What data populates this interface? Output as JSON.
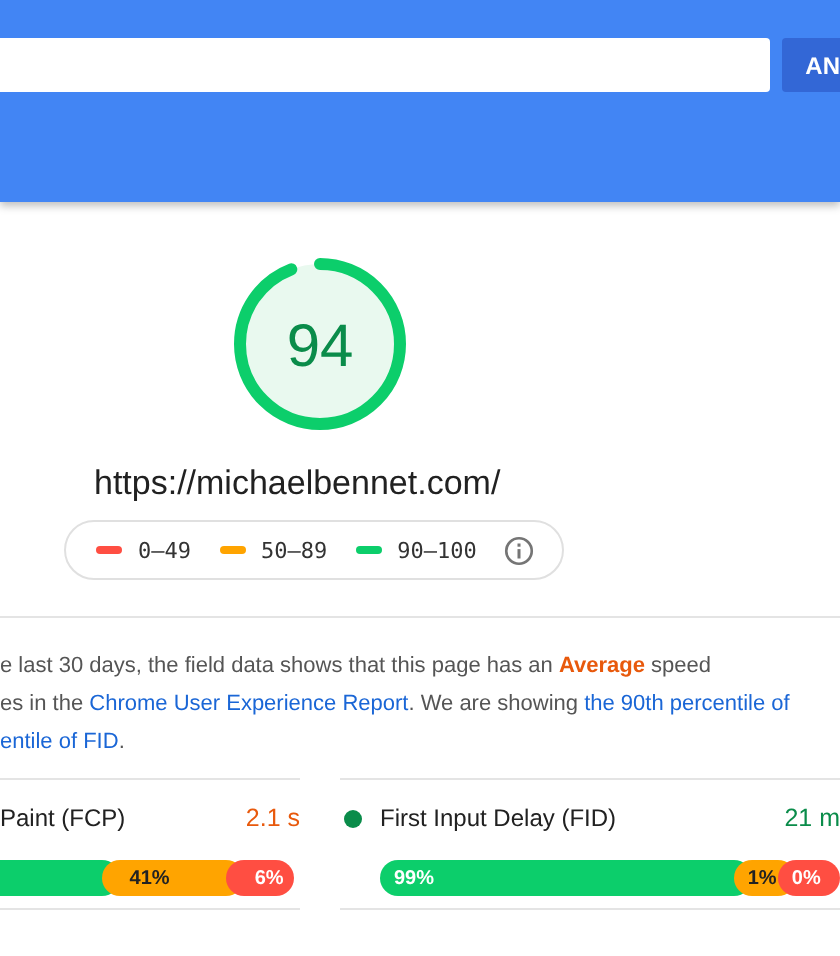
{
  "header": {
    "analyze_button": "AN"
  },
  "score": {
    "value": "94"
  },
  "url": "https://michaelbennet.com/",
  "legend": [
    {
      "label": "0–49",
      "color": "#ff4e42"
    },
    {
      "label": "50–89",
      "color": "#ffa400"
    },
    {
      "label": "90–100",
      "color": "#0cce6b"
    }
  ],
  "summary": [
    [
      {
        "kind": "text",
        "text": "e last 30 days, the field data shows that this page has an "
      },
      {
        "kind": "highlight",
        "text": "Average"
      },
      {
        "kind": "text",
        "text": " speed"
      }
    ],
    [
      {
        "kind": "text",
        "text": "es in the "
      },
      {
        "kind": "link",
        "text": "Chrome User Experience Report"
      },
      {
        "kind": "text",
        "text": ". We are showing "
      },
      {
        "kind": "link",
        "text": "the 90th percentile of"
      }
    ],
    [
      {
        "kind": "link",
        "text": "entile of FID"
      },
      {
        "kind": "text",
        "text": "."
      }
    ]
  ],
  "metrics": [
    {
      "name": "Paint (FCP)",
      "value": "2.1 s",
      "color": "#e8590c",
      "dot": false,
      "segments": [
        {
          "color": "#0cce6b"
        },
        {
          "label": "41%",
          "color": "#ffa400"
        },
        {
          "label": "6%",
          "color": "#ff4e42"
        }
      ]
    },
    {
      "name": "First Input Delay (FID)",
      "value": "21 m",
      "color": "#0a8c4a",
      "dot": true,
      "segments": [
        {
          "label": "99%",
          "color": "#0cce6b"
        },
        {
          "label": "1%",
          "color": "#ffa400"
        },
        {
          "label": "0%",
          "color": "#ff4e42"
        }
      ]
    }
  ]
}
